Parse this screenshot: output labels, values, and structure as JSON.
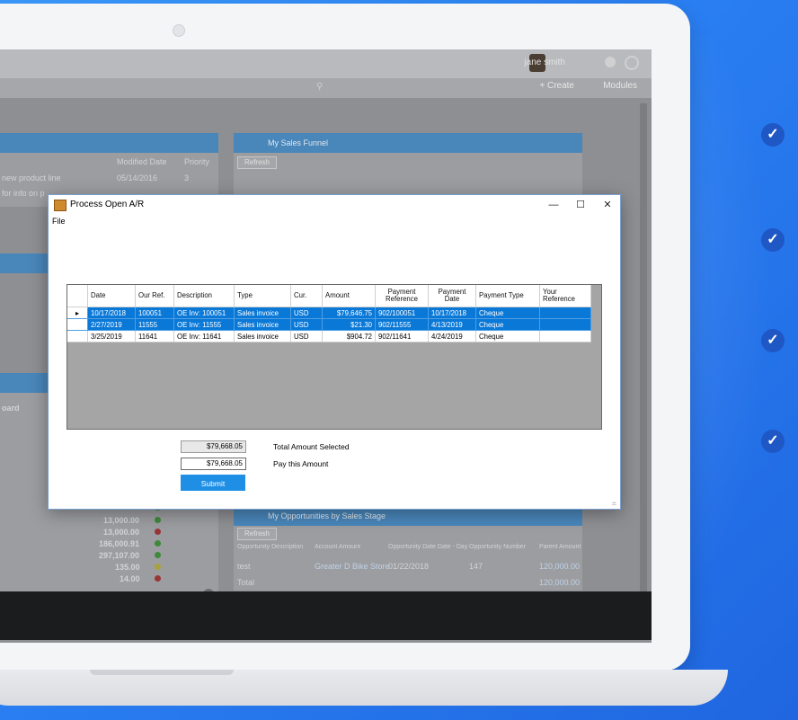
{
  "dialog": {
    "title": "Process Open A/R",
    "menu_file": "File",
    "controls": {
      "minimize": "—",
      "maximize": "☐",
      "close": "✕"
    },
    "grid": {
      "columns": [
        "Date",
        "Our Ref.",
        "Description",
        "Type",
        "Cur.",
        "Amount",
        "Payment Reference",
        "Payment Date",
        "Payment Type",
        "Your Reference"
      ],
      "rows": [
        {
          "selected": true,
          "current": true,
          "cells": [
            "10/17/2018",
            "100051",
            "OE Inv: 100051",
            "Sales invoice",
            "USD",
            "$79,646.75",
            "902/100051",
            "10/17/2018",
            "Cheque",
            ""
          ]
        },
        {
          "selected": true,
          "current": false,
          "cells": [
            "2/27/2019",
            "11555",
            "OE Inv: 11555",
            "Sales invoice",
            "USD",
            "$21.30",
            "902/11555",
            "4/13/2019",
            "Cheque",
            ""
          ]
        },
        {
          "selected": false,
          "current": false,
          "cells": [
            "3/25/2019",
            "11641",
            "OE Inv: 11641",
            "Sales invoice",
            "USD",
            "$904.72",
            "902/11641",
            "4/24/2019",
            "Cheque",
            ""
          ]
        }
      ]
    },
    "total_amount_value": "$79,668.05",
    "total_amount_label": "Total Amount Selected",
    "pay_amount_value": "$79,668.05",
    "pay_amount_label": "Pay this Amount",
    "submit_label": "Submit"
  },
  "background_app": {
    "user_name": "jane smith",
    "create_label": "+ Create",
    "modules_label": "Modules",
    "sales_funnel_title": "My Sales Funnel",
    "refresh_label": "Refresh",
    "modified_date_header": "Modified Date",
    "priority_header": "Priority",
    "row1_text": "new product line",
    "row1_date": "05/14/2016",
    "row1_priority": "3",
    "row2_text": "for info on p",
    "lower_panel_text": "oard",
    "amounts": [
      "13,000.00",
      "13,000.00",
      "186,000.91",
      "297,107.00",
      "135.00",
      "14.00"
    ],
    "opp_panel_title": "My Opportunities by Sales Stage",
    "opp_headers": [
      "Opportunity Description",
      "Account Amount",
      "Opportunity Date Date - Day",
      "Opportunity Number",
      "Parent Amount"
    ],
    "opp_row": [
      "test",
      "Greater D Bike Store",
      "01/22/2018",
      "147",
      "120,000.00"
    ],
    "opp_total_label": "Total",
    "opp_total_value": "120,000.00"
  },
  "colors": {
    "selection": "#0a78d7",
    "submit": "#1f8fe6",
    "background": "#2a7ff2",
    "check_badge": "#1f57c4"
  },
  "check_icons": [
    "check-icon",
    "check-icon",
    "check-icon",
    "check-icon"
  ]
}
